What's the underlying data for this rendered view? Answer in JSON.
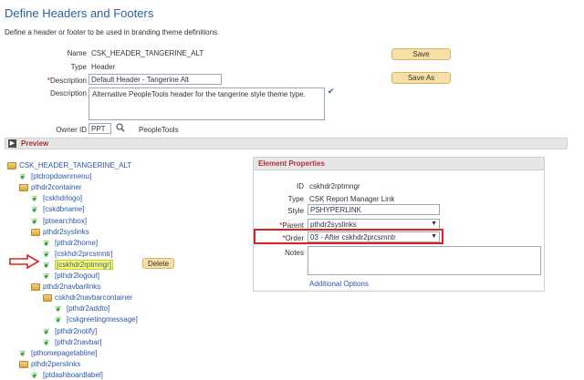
{
  "header": {
    "title": "Define Headers and Footers",
    "subtitle": "Define a header or footer to be used in branding theme definitions."
  },
  "form": {
    "name_label": "Name",
    "name_value": "CSK_HEADER_TANGERINE_ALT",
    "type_label": "Type",
    "type_value": "Header",
    "description_label": "*Description",
    "description_value": "Default Header - Tangerine Alt",
    "long_description_label": "Description",
    "long_description_value": "Alternative PeopleTools header for the tangerine style theme type.",
    "owner_label": "Owner ID",
    "owner_value": "PPT",
    "owner_desc": "PeopleTools",
    "save_label": "Save",
    "save_as_label": "Save As"
  },
  "preview": {
    "label": "Preview",
    "toggle": "▶"
  },
  "tree": {
    "root": "CSK_HEADER_TANGERINE_ALT",
    "items": [
      {
        "label": "[ptdropdownmenu]",
        "kind": "leaf",
        "level": 1
      },
      {
        "label": "pthdr2container",
        "kind": "folder",
        "level": 1
      },
      {
        "label": "[cskhdrlogo]",
        "kind": "leaf",
        "level": 2
      },
      {
        "label": "[cskdbname]",
        "kind": "leaf",
        "level": 2
      },
      {
        "label": "[ptsearchbox]",
        "kind": "leaf",
        "level": 2
      },
      {
        "label": "pthdr2syslinks",
        "kind": "folder",
        "level": 2
      },
      {
        "label": "[pthdr2home]",
        "kind": "leaf",
        "level": 3
      },
      {
        "label": "[cskhdr2prcsmntr]",
        "kind": "leaf",
        "level": 3
      },
      {
        "label": "[cskhdr2rptmngr]",
        "kind": "leaf",
        "level": 3
      },
      {
        "label": "[pthdr2logout]",
        "kind": "leaf",
        "level": 3
      },
      {
        "label": "pthdr2navbarlinks",
        "kind": "folder",
        "level": 2
      },
      {
        "label": "cskhdr2navbarcontainer",
        "kind": "folder",
        "level": 3
      },
      {
        "label": "[pthdr2addto]",
        "kind": "leaf",
        "level": 4
      },
      {
        "label": "[cskgreetingmessage]",
        "kind": "leaf",
        "level": 4
      },
      {
        "label": "[pthdr2notify]",
        "kind": "leaf",
        "level": 3
      },
      {
        "label": "[pthdr2navbar]",
        "kind": "leaf",
        "level": 3
      },
      {
        "label": "[pthomepagetabline]",
        "kind": "leaf",
        "level": 1
      },
      {
        "label": "pthdr2perslinks",
        "kind": "folder",
        "level": 1
      },
      {
        "label": "[ptdashboardlabel]",
        "kind": "leaf",
        "level": 2
      }
    ],
    "delete_label": "Delete"
  },
  "element_properties": {
    "title": "Element Properties",
    "id_label": "ID",
    "id_value": "cskhdr2rptmngr",
    "type_label": "Type",
    "type_value": "CSK Report Manager Link",
    "style_label": "Style",
    "style_value": "PSHYPERLINK",
    "parent_label": "*Parent",
    "parent_value": "pthdr2syslinks",
    "order_label": "*Order",
    "order_value": "03 - After cskhdr2prcsmntr",
    "notes_label": "Notes",
    "notes_value": "",
    "additional_options": "Additional Options"
  },
  "colors": {
    "title": "#2b5f9e",
    "button_bg": "#f7dfa6",
    "highlight": "#ffff66",
    "red_marker": "#e02020",
    "leaf_green": "#3aa336"
  }
}
